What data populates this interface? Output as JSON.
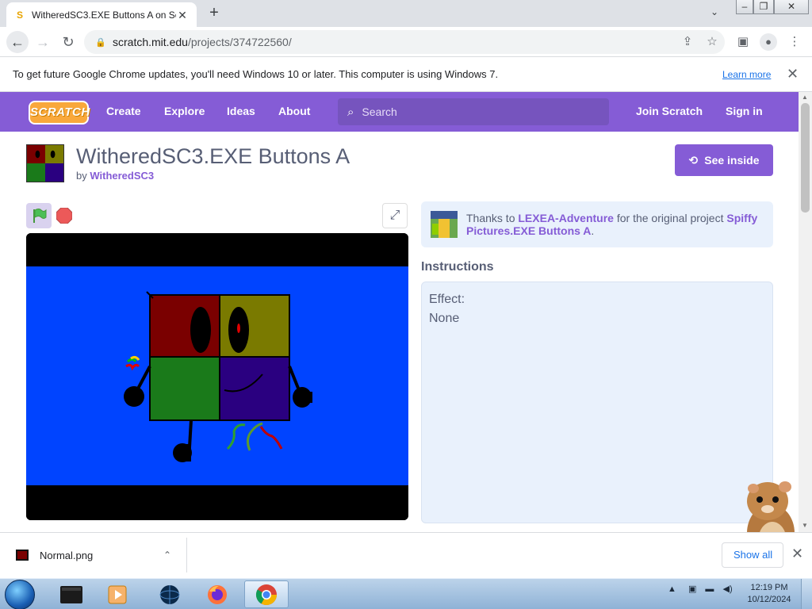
{
  "browser": {
    "tab_title": "WitheredSC3.EXE Buttons A on Scratch",
    "url_host": "scratch.mit.edu",
    "url_path": "/projects/374722560/",
    "infobar_message": "To get future Google Chrome updates, you'll need Windows 10 or later. This computer is using Windows 7.",
    "infobar_link": "Learn more"
  },
  "scratch_nav": {
    "logo": "SCRATCH",
    "items": [
      "Create",
      "Explore",
      "Ideas",
      "About"
    ],
    "search_placeholder": "Search",
    "join": "Join Scratch",
    "sign_in": "Sign in"
  },
  "project": {
    "title": "WitheredSC3.EXE Buttons A",
    "by_prefix": "by",
    "author": "WitheredSC3",
    "see_inside": "See inside",
    "credits_prefix": "Thanks to",
    "credits_user": "LEXEA-Adventure",
    "credits_middle": "for the original project",
    "credits_project": "Spiffy Pictures.EXE Buttons A",
    "credits_suffix": ".",
    "instructions_heading": "Instructions",
    "instructions_lines": [
      "Effect:",
      "None"
    ]
  },
  "downloads": {
    "file_name": "Normal.png",
    "show_all": "Show all"
  },
  "taskbar": {
    "time": "12:19 PM",
    "date": "10/12/2024"
  },
  "colors": {
    "scratch_purple": "#855cd6",
    "stage_blue": "#0044ff"
  }
}
